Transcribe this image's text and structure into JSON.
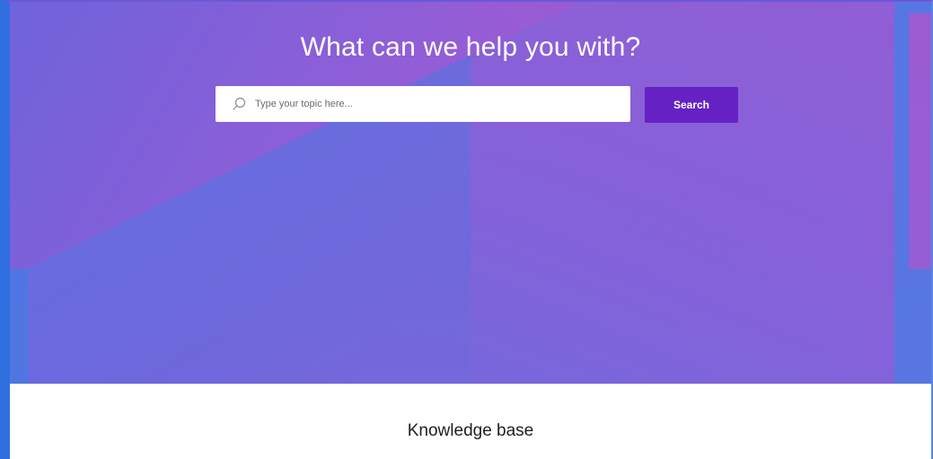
{
  "hero": {
    "headline": "What can we help you with?",
    "colors": {
      "gradient_start": "#6f63dc",
      "gradient_mid": "#9b5bd4",
      "gradient_end": "#5376e0"
    }
  },
  "search": {
    "placeholder": "Type your topic here...",
    "value": "",
    "icon": "search-icon",
    "button_label": "Search",
    "button_color": "#6521c3"
  },
  "content": {
    "section_title": "Knowledge base"
  }
}
